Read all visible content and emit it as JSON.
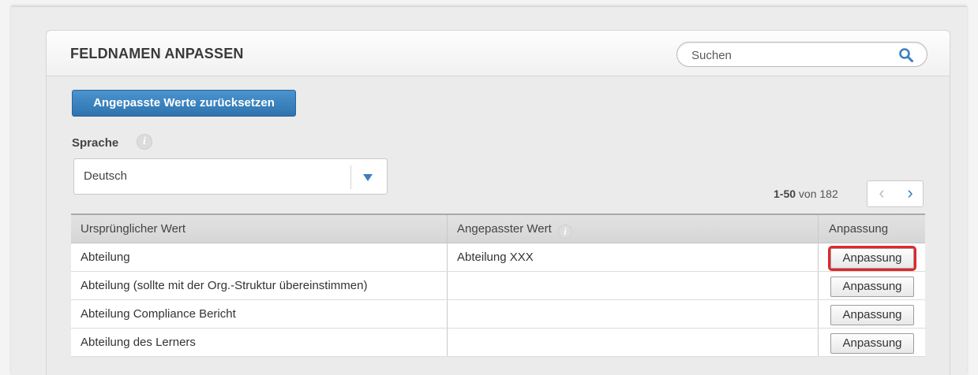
{
  "panel": {
    "title": "FELDNAMEN ANPASSEN",
    "search_placeholder": "Suchen"
  },
  "toolbar": {
    "reset_label": "Angepasste Werte zurücksetzen"
  },
  "language": {
    "label": "Sprache",
    "info_glyph": "i",
    "selected": "Deutsch"
  },
  "pagination": {
    "range": "1-50",
    "of_label": "von 182",
    "prev_glyph": "‹",
    "next_glyph": "›"
  },
  "table": {
    "headers": {
      "original": "Ursprünglicher Wert",
      "custom": "Angepasster Wert",
      "action": "Anpassung"
    },
    "rows": [
      {
        "original": "Abteilung",
        "custom": "Abteilung XXX",
        "action": "Anpassung"
      },
      {
        "original": "Abteilung (sollte mit der Org.-Struktur übereinstimmen)",
        "custom": "",
        "action": "Anpassung"
      },
      {
        "original": "Abteilung Compliance Bericht",
        "custom": "",
        "action": "Anpassung"
      },
      {
        "original": "Abteilung des Lerners",
        "custom": "",
        "action": "Anpassung"
      }
    ]
  },
  "colors": {
    "accent": "#3d7fbd",
    "highlight": "#e3262b"
  },
  "icons": {
    "search": "search-icon",
    "info": "info-icon",
    "caret": "chevron-down-icon"
  }
}
